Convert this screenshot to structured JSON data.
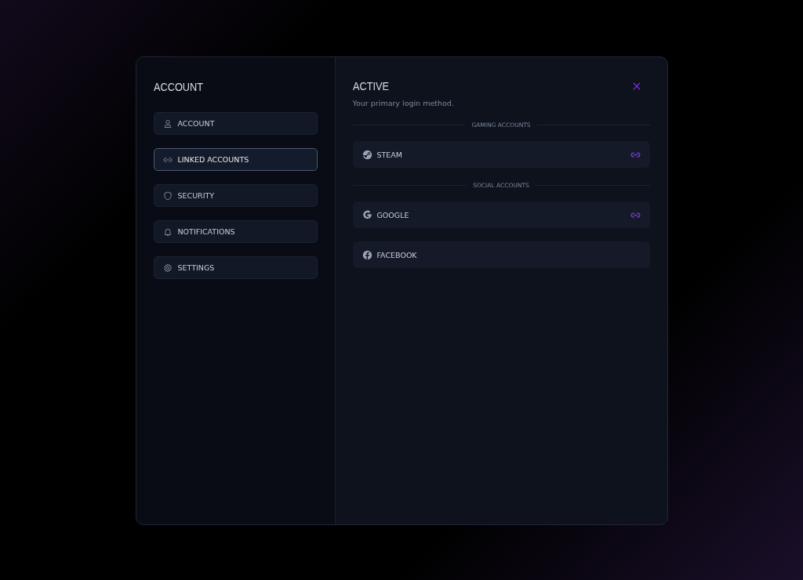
{
  "sidebar": {
    "title": "ACCOUNT",
    "items": [
      {
        "label": "ACCOUNT",
        "kind": "user",
        "selected": false
      },
      {
        "label": "LINKED ACCOUNTS",
        "kind": "link",
        "selected": true
      },
      {
        "label": "SECURITY",
        "kind": "shield",
        "selected": false
      },
      {
        "label": "NOTIFICATIONS",
        "kind": "bell",
        "selected": false
      },
      {
        "label": "SETTINGS",
        "kind": "gear",
        "selected": false
      }
    ]
  },
  "main": {
    "title": "ACTIVE",
    "subtitle": "Your primary login method.",
    "sections": [
      {
        "heading": "GAMING ACCOUNTS",
        "accounts": [
          {
            "name": "STEAM",
            "kind": "steam",
            "linked": true
          }
        ]
      },
      {
        "heading": "SOCIAL ACCOUNTS",
        "accounts": [
          {
            "name": "GOOGLE",
            "kind": "google",
            "linked": true
          },
          {
            "name": "FACEBOOK",
            "kind": "facebook",
            "linked": false
          }
        ]
      }
    ]
  }
}
